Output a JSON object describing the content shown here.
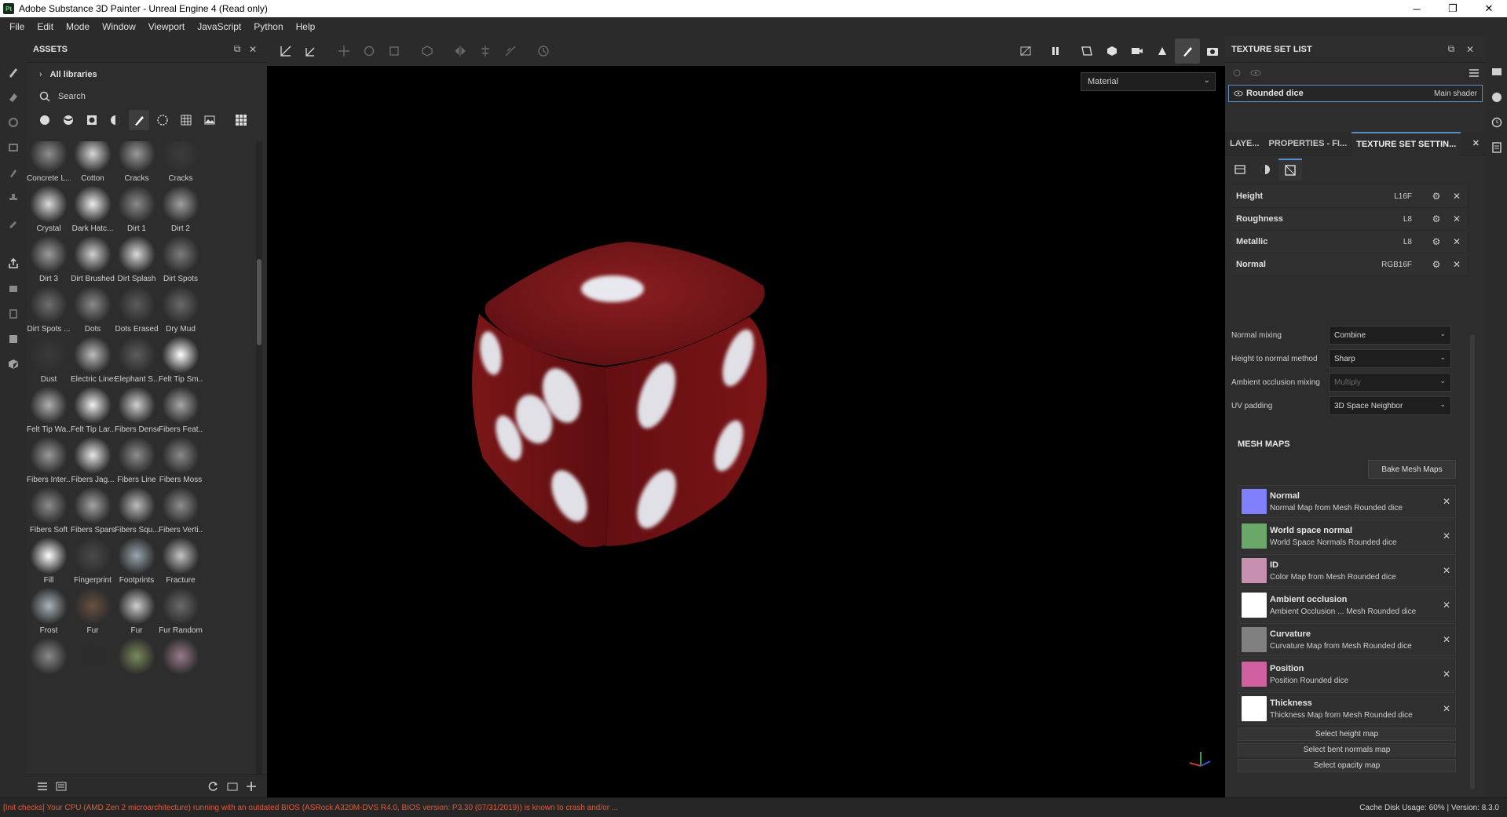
{
  "window": {
    "app_icon": "Pt",
    "title": "Adobe Substance 3D Painter - Unreal Engine 4 (Read only)",
    "minimize": "─",
    "maximize": "❐",
    "close": "✕"
  },
  "menu": [
    "File",
    "Edit",
    "Mode",
    "Window",
    "Viewport",
    "JavaScript",
    "Python",
    "Help"
  ],
  "assets": {
    "title": "ASSETS",
    "libraries": "All libraries",
    "search_placeholder": "Search",
    "brushes": [
      {
        "label": "Concrete L...",
        "color": "#8e8e8e"
      },
      {
        "label": "Cotton",
        "color": "#d8d8d8"
      },
      {
        "label": "Cracks",
        "color": "#9a9a9a"
      },
      {
        "label": "Cracks",
        "color": "#3c3c3c"
      },
      {
        "label": "Crystal",
        "color": "#dcdcdc"
      },
      {
        "label": "Dark Hatc...",
        "color": "#eeeeee"
      },
      {
        "label": "Dirt 1",
        "color": "#8a8a8a"
      },
      {
        "label": "Dirt 2",
        "color": "#a0a0a0"
      },
      {
        "label": "Dirt 3",
        "color": "#9c9c9c"
      },
      {
        "label": "Dirt Brushed",
        "color": "#d0d0d0"
      },
      {
        "label": "Dirt Splash",
        "color": "#dadada"
      },
      {
        "label": "Dirt Spots",
        "color": "#7c7c7c"
      },
      {
        "label": "Dirt Spots ...",
        "color": "#6e6e6e"
      },
      {
        "label": "Dots",
        "color": "#8a8a8a"
      },
      {
        "label": "Dots Erased",
        "color": "#5a5a5a"
      },
      {
        "label": "Dry Mud",
        "color": "#6a6a6a"
      },
      {
        "label": "Dust",
        "color": "#3a3a3a"
      },
      {
        "label": "Electric Lines",
        "color": "#bdbdbd"
      },
      {
        "label": "Elephant S...",
        "color": "#5c5c5c"
      },
      {
        "label": "Felt Tip Sm...",
        "color": "#ffffff"
      },
      {
        "label": "Felt Tip Wa...",
        "color": "#b0b0b0"
      },
      {
        "label": "Felt Tip Lar...",
        "color": "#f0f0f0"
      },
      {
        "label": "Fibers Dense",
        "color": "#d0d0d0"
      },
      {
        "label": "Fibers Feat...",
        "color": "#a8a8a8"
      },
      {
        "label": "Fibers Inter...",
        "color": "#9a9a9a"
      },
      {
        "label": "Fibers Jag...",
        "color": "#e8e8e8"
      },
      {
        "label": "Fibers Line",
        "color": "#8c8c8c"
      },
      {
        "label": "Fibers Moss",
        "color": "#8a8a8a"
      },
      {
        "label": "Fibers Soft",
        "color": "#8c8c8c"
      },
      {
        "label": "Fibers Sparse",
        "color": "#a4a4a4"
      },
      {
        "label": "Fibers Squ...",
        "color": "#bcbcbc"
      },
      {
        "label": "Fibers Verti...",
        "color": "#8e8e8e"
      },
      {
        "label": "Fill",
        "color": "#ffffff"
      },
      {
        "label": "Fingerprint",
        "color": "#4a4a4a"
      },
      {
        "label": "Footprints",
        "color": "#9aa6b0"
      },
      {
        "label": "Fracture",
        "color": "#c4c4c4"
      },
      {
        "label": "Frost",
        "color": "#a8b4bc"
      },
      {
        "label": "Fur",
        "color": "#6a5040"
      },
      {
        "label": "Fur",
        "color": "#cfcfcf"
      },
      {
        "label": "Fur Random",
        "color": "#6a6a6a"
      },
      {
        "label": "",
        "color": "#8a8a8a"
      },
      {
        "label": "",
        "color": "#2c2c2c"
      },
      {
        "label": "",
        "color": "#7a8a5a"
      },
      {
        "label": "",
        "color": "#9a7a8a"
      }
    ]
  },
  "viewport": {
    "mode_select": "Material"
  },
  "texture_set_list": {
    "title": "TEXTURE SET LIST",
    "set_name": "Rounded dice",
    "shader": "Main shader"
  },
  "tabs": [
    "LAYE...",
    "PROPERTIES - FI...",
    "TEXTURE SET SETTIN..."
  ],
  "channels": [
    {
      "name": "Height",
      "format": "L16F"
    },
    {
      "name": "Roughness",
      "format": "L8"
    },
    {
      "name": "Metallic",
      "format": "L8"
    },
    {
      "name": "Normal",
      "format": "RGB16F"
    }
  ],
  "settings": [
    {
      "label": "Normal mixing",
      "value": "Combine"
    },
    {
      "label": "Height to normal method",
      "value": "Sharp"
    },
    {
      "label": "Ambient occlusion mixing",
      "value": "Multiply"
    },
    {
      "label": "UV padding",
      "value": "3D Space Neighbor"
    }
  ],
  "mesh_maps": {
    "title": "MESH MAPS",
    "bake_button": "Bake Mesh Maps",
    "items": [
      {
        "name": "Normal",
        "sub": "Normal Map from Mesh Rounded dice",
        "thumb": "#8080ff"
      },
      {
        "name": "World space normal",
        "sub": "World Space Normals Rounded dice",
        "thumb": "#6aa86a"
      },
      {
        "name": "ID",
        "sub": "Color Map from Mesh Rounded dice",
        "thumb": "#c890b0"
      },
      {
        "name": "Ambient occlusion",
        "sub": "Ambient Occlusion ... Mesh Rounded dice",
        "thumb": "#ffffff"
      },
      {
        "name": "Curvature",
        "sub": "Curvature Map from Mesh Rounded dice",
        "thumb": "#808080"
      },
      {
        "name": "Position",
        "sub": "Position Rounded dice",
        "thumb": "#d060a0"
      },
      {
        "name": "Thickness",
        "sub": "Thickness Map from Mesh Rounded dice",
        "thumb": "#ffffff"
      }
    ],
    "select_buttons": [
      "Select height map",
      "Select bent normals map",
      "Select opacity map"
    ]
  },
  "status": {
    "warning": "[Init checks] Your CPU (AMD Zen 2 microarchitecture) running with an outdated BIOS (ASRock A320M-DVS R4.0, BIOS version: P3.30 (07/31/2019)) is known to crash and/or ...",
    "cache": "Cache Disk Usage:    60% | Version: 8.3.0"
  },
  "colors": {
    "accent": "#5b8ec9",
    "dice_red": "#7a1416",
    "warning": "#e05a3a"
  }
}
